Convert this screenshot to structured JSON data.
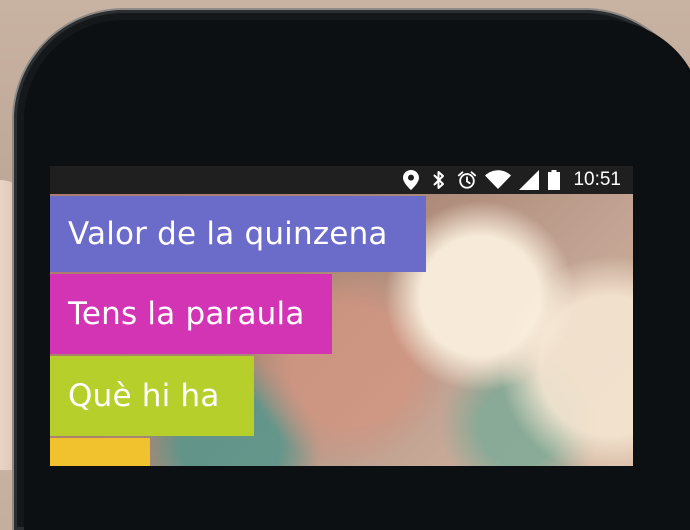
{
  "status_bar": {
    "time": "10:51",
    "icons": [
      "location-icon",
      "bluetooth-icon",
      "alarm-icon",
      "wifi-icon",
      "signal-icon",
      "battery-icon"
    ]
  },
  "menu": {
    "items": [
      {
        "label": "Valor de la quinzena",
        "color": "#6b6bc9"
      },
      {
        "label": "Tens la paraula",
        "color": "#d334b3"
      },
      {
        "label": "Què hi ha",
        "color": "#b7cf2b"
      },
      {
        "label": "",
        "color": "#f2c12e"
      }
    ]
  },
  "colors": {
    "status_bar_bg": "#1f1f1f",
    "phone_body": "#15181a"
  }
}
